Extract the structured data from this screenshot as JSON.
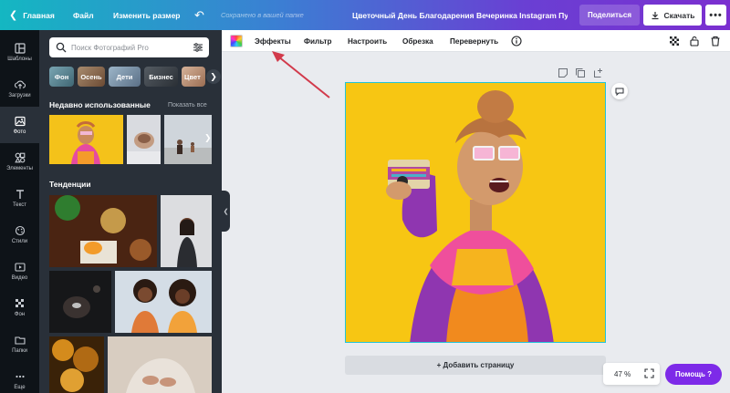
{
  "topbar": {
    "home_label": "Главная",
    "file_label": "Файл",
    "resize_label": "Изменить размер",
    "untitled_text": "Сохранено в вашей папке",
    "doc_title": "Цветочный День Благодарения Вечеринка Instagram Пу...",
    "share_label": "Поделиться",
    "download_label": "Скачать",
    "more_label": "•••"
  },
  "rail": {
    "items": [
      {
        "label": "Шаблоны",
        "icon": "templates-icon"
      },
      {
        "label": "Загрузки",
        "icon": "upload-icon"
      },
      {
        "label": "Фото",
        "icon": "photo-icon"
      },
      {
        "label": "Элементы",
        "icon": "elements-icon"
      },
      {
        "label": "Текст",
        "icon": "text-icon"
      },
      {
        "label": "Стили",
        "icon": "styles-icon"
      },
      {
        "label": "Видео",
        "icon": "video-icon"
      },
      {
        "label": "Фон",
        "icon": "background-icon"
      },
      {
        "label": "Папки",
        "icon": "folder-icon"
      },
      {
        "label": "Еще",
        "icon": "more-icon"
      }
    ],
    "active_index": 2
  },
  "panel": {
    "search_placeholder": "Поиск Фотографий Pro",
    "chips": [
      "Фон",
      "Осень",
      "Дети",
      "Бизнес",
      "Цвет"
    ],
    "recent_title": "Недавно использованные",
    "show_all": "Показать все",
    "trends_title": "Тенденции"
  },
  "toolbar": {
    "effects": "Эффекты",
    "filter": "Фильтр",
    "adjust": "Настроить",
    "crop": "Обрезка",
    "flip": "Перевернуть"
  },
  "canvas": {
    "add_page": "+ Добавить страницу",
    "zoom": "47 %",
    "help": "Помощь ?"
  },
  "colors": {
    "accent": "#7d2ae8",
    "canvas_bg": "#f6c712",
    "panel_bg": "#293039",
    "rail_bg": "#0e1318",
    "selection": "#23c4d8",
    "arrow": "#d23a4b"
  }
}
